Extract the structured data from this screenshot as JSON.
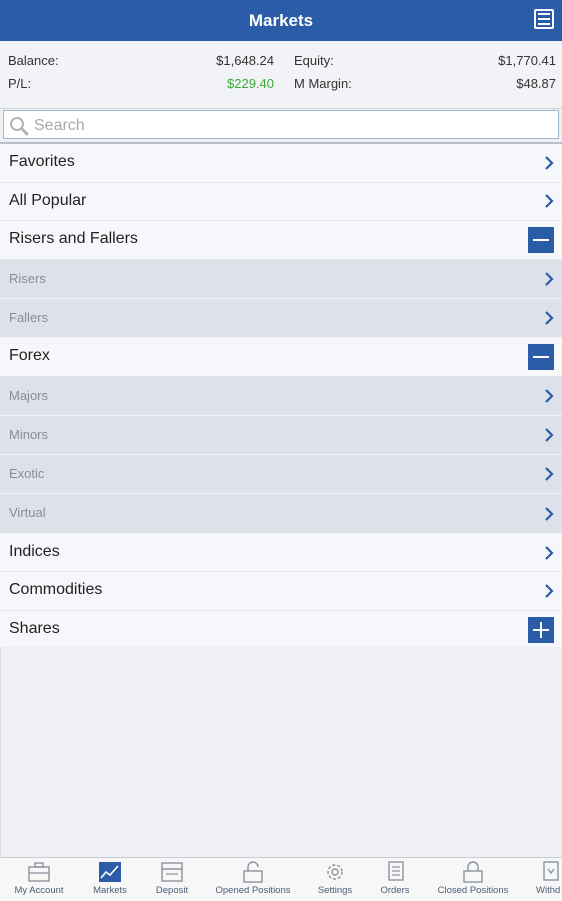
{
  "header": {
    "title": "Markets",
    "menu_icon": "hamburger-menu-icon"
  },
  "account": {
    "balance_label": "Balance:",
    "balance_value": "$1,648.24",
    "equity_label": "Equity:",
    "equity_value": "$1,770.41",
    "pl_label": "P/L:",
    "pl_value": "$229.40",
    "margin_label": "M Margin:",
    "margin_value": "$48.87"
  },
  "search": {
    "placeholder": "Search",
    "value": ""
  },
  "markets": {
    "favorites": "Favorites",
    "all_popular": "All Popular",
    "risers_fallers": "Risers and Fallers",
    "risers": "Risers",
    "fallers": "Fallers",
    "forex": "Forex",
    "majors": "Majors",
    "minors": "Minors",
    "exotic": "Exotic",
    "virtual": "Virtual",
    "indices": "Indices",
    "commodities": "Commodities",
    "shares": "Shares"
  },
  "tabs": {
    "my_account": "My Account",
    "markets": "Markets",
    "deposit": "Deposit",
    "opened_positions": "Opened Positions",
    "settings": "Settings",
    "orders": "Orders",
    "closed_positions": "Closed Positions",
    "withdraw": "Withd"
  },
  "colors": {
    "accent": "#2a5ca8",
    "profit": "#3caa3c",
    "sub_row_bg": "#dde1ea"
  }
}
